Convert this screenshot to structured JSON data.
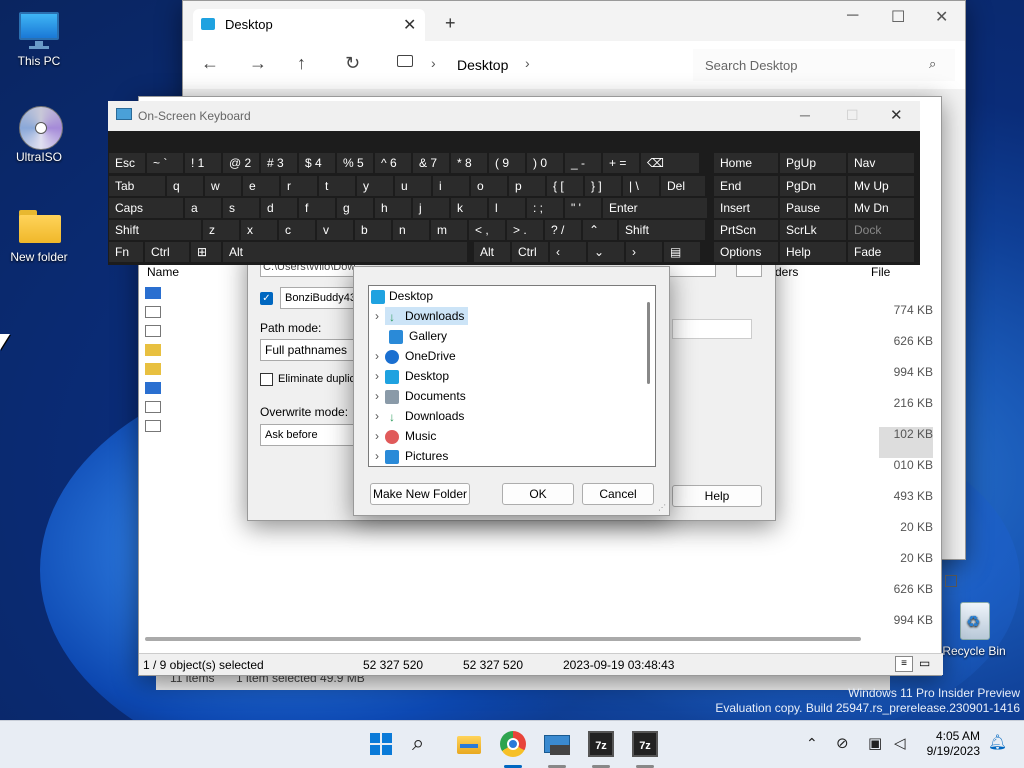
{
  "desktop": {
    "icons": [
      {
        "label": "This PC",
        "icon": "monitor-icon"
      },
      {
        "label": "UltraISO",
        "icon": "disc-icon"
      },
      {
        "label": "New folder",
        "icon": "folder-icon"
      },
      {
        "label": "Recycle Bin",
        "icon": "recycle-bin-icon"
      }
    ],
    "watermark": {
      "line1": "Windows 11 Pro Insider Preview",
      "line2": "Evaluation copy. Build 25947.rs_prerelease.230901-1416"
    }
  },
  "explorer": {
    "tab_title": "Desktop",
    "new_tab": "+",
    "address": "Desktop",
    "search_placeholder": "Search Desktop",
    "status_items": "11 items",
    "status_selected": "1 item selected  49.9 MB"
  },
  "sevenzip": {
    "column_name": "Name",
    "column_folders": "ders",
    "column_file": "File",
    "sizes": [
      "774 KB",
      "626 KB",
      "994 KB",
      "216 KB",
      "102 KB",
      "010 KB",
      "493 KB",
      "20 KB",
      "20 KB",
      "626 KB",
      "994 KB"
    ],
    "status": {
      "selected": "1 / 9 object(s) selected",
      "size1": "52 327 520",
      "size2": "52 327 520",
      "date": "2023-09-19 03:48:43"
    }
  },
  "extract_dialog": {
    "path_value": "C:\\Users\\Wilo\\Dow",
    "checkbox_label": "BonziBuddy43",
    "path_mode_label": "Path mode:",
    "path_mode_value": "Full pathnames",
    "eliminate_label": "Eliminate duplica",
    "overwrite_label": "Overwrite mode:",
    "overwrite_value": "Ask before overwrit",
    "help": "Help"
  },
  "browse_dialog": {
    "root": "Desktop",
    "items": [
      "Downloads",
      "Gallery",
      "OneDrive",
      "Desktop",
      "Documents",
      "Downloads",
      "Music",
      "Pictures"
    ],
    "make_folder": "Make New Folder",
    "ok": "OK",
    "cancel": "Cancel"
  },
  "osk": {
    "title": "On-Screen Keyboard",
    "row1": [
      "Esc",
      "~ `",
      "! 1",
      "@ 2",
      "# 3",
      "$ 4",
      "% 5",
      "^ 6",
      "& 7",
      "* 8",
      "( 9",
      ") 0",
      "_ -",
      "+ ="
    ],
    "row2": [
      "Tab",
      "q",
      "w",
      "e",
      "r",
      "t",
      "y",
      "u",
      "i",
      "o",
      "p",
      "{ [",
      "} ]",
      "| \\",
      "Del"
    ],
    "row3": [
      "Caps",
      "a",
      "s",
      "d",
      "f",
      "g",
      "h",
      "j",
      "k",
      "l",
      ": ;",
      "\" '",
      "Enter"
    ],
    "row4": [
      "Shift",
      "z",
      "x",
      "c",
      "v",
      "b",
      "n",
      "m",
      "< ,",
      "> .",
      "? /",
      "Shift"
    ],
    "row5": [
      "Fn",
      "Ctrl",
      "Alt",
      "Alt",
      "Ctrl"
    ],
    "nav": [
      "Home",
      "PgUp",
      "Nav",
      "End",
      "PgDn",
      "Mv Up",
      "Insert",
      "Pause",
      "Mv Dn",
      "PrtScn",
      "ScrLk",
      "Dock",
      "Options",
      "Help",
      "Fade"
    ]
  },
  "taskbar": {
    "time": "4:05 AM",
    "date": "9/19/2023"
  },
  "colors": {
    "accent": "#0067c0",
    "osk_bg": "#1c1c1c",
    "osk_key": "#2b2b2b"
  }
}
